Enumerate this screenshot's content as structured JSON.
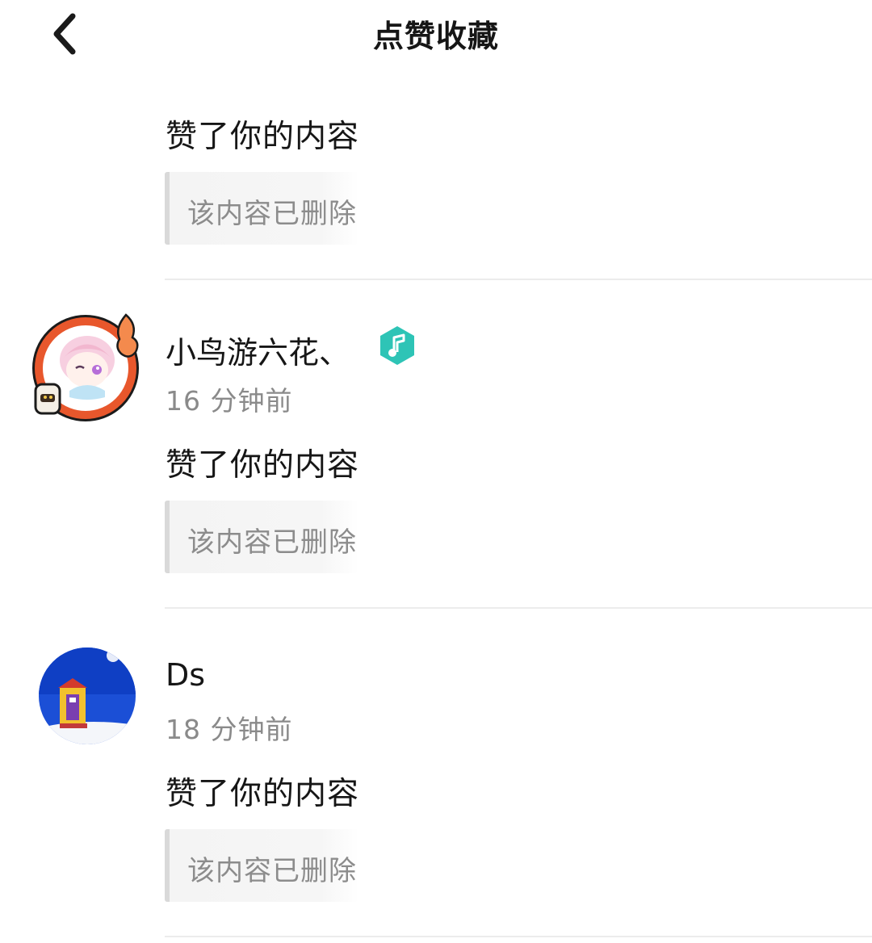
{
  "header": {
    "title": "点赞收藏",
    "back_icon": "chevron-left-icon"
  },
  "items": [
    {
      "user": "",
      "time": "",
      "action": "赞了你的内容",
      "content": "该内容已删除"
    },
    {
      "user": "小鸟游六花、",
      "badge_icon": "music-note-icon",
      "badge_color": "#2ec4b6",
      "time": "16 分钟前",
      "action": "赞了你的内容",
      "content": "该内容已删除"
    },
    {
      "user": "Ds",
      "time": "18 分钟前",
      "action": "赞了你的内容",
      "content": "该内容已删除"
    }
  ]
}
